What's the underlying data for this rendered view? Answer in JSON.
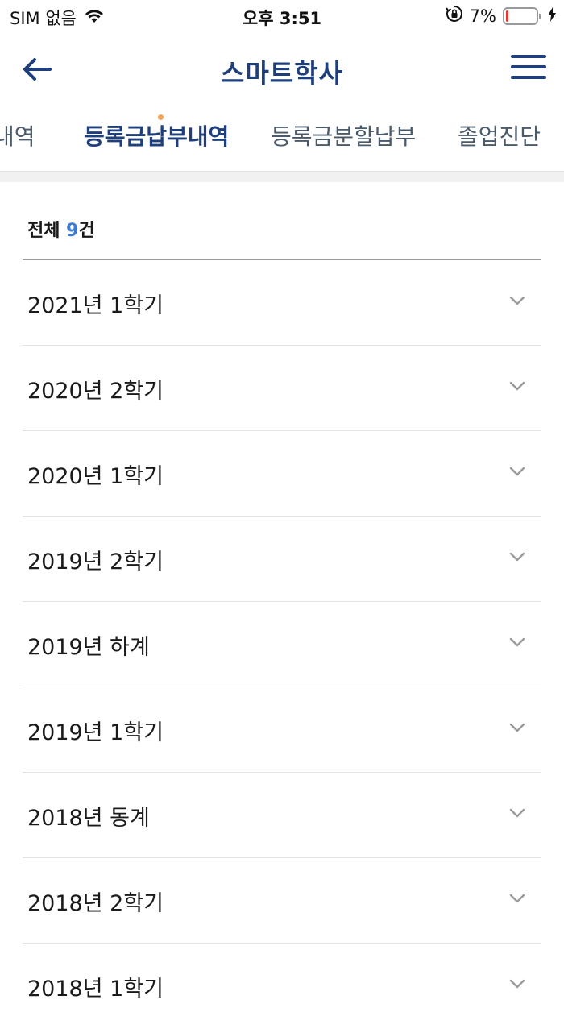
{
  "status_bar": {
    "carrier": "SIM 없음",
    "time": "오후 3:51",
    "battery_percent": "7%",
    "battery_level": 0.07,
    "icons": [
      "wifi-icon",
      "rotation-lock-icon",
      "battery-icon",
      "charging-icon"
    ]
  },
  "header": {
    "title": "스마트학사",
    "back_icon": "arrow-left-icon",
    "menu_icon": "hamburger-menu-icon"
  },
  "tabs": [
    {
      "label": "내역"
    },
    {
      "label": "등록금납부내역",
      "active": true
    },
    {
      "label": "등록금분할납부"
    },
    {
      "label": "졸업진단"
    }
  ],
  "summary": {
    "prefix": "전체",
    "count": "9",
    "suffix": "건"
  },
  "items": [
    {
      "label": "2021년 1학기"
    },
    {
      "label": "2020년 2학기"
    },
    {
      "label": "2020년 1학기"
    },
    {
      "label": "2019년 2학기"
    },
    {
      "label": "2019년 하계"
    },
    {
      "label": "2019년 1학기"
    },
    {
      "label": "2018년 동계"
    },
    {
      "label": "2018년 2학기"
    },
    {
      "label": "2018년 1학기"
    }
  ],
  "colors": {
    "brand": "#1e3f7b",
    "accent_count": "#3b7bd3",
    "battery_low": "#e53935",
    "tab_dot": "#f5a25a"
  }
}
